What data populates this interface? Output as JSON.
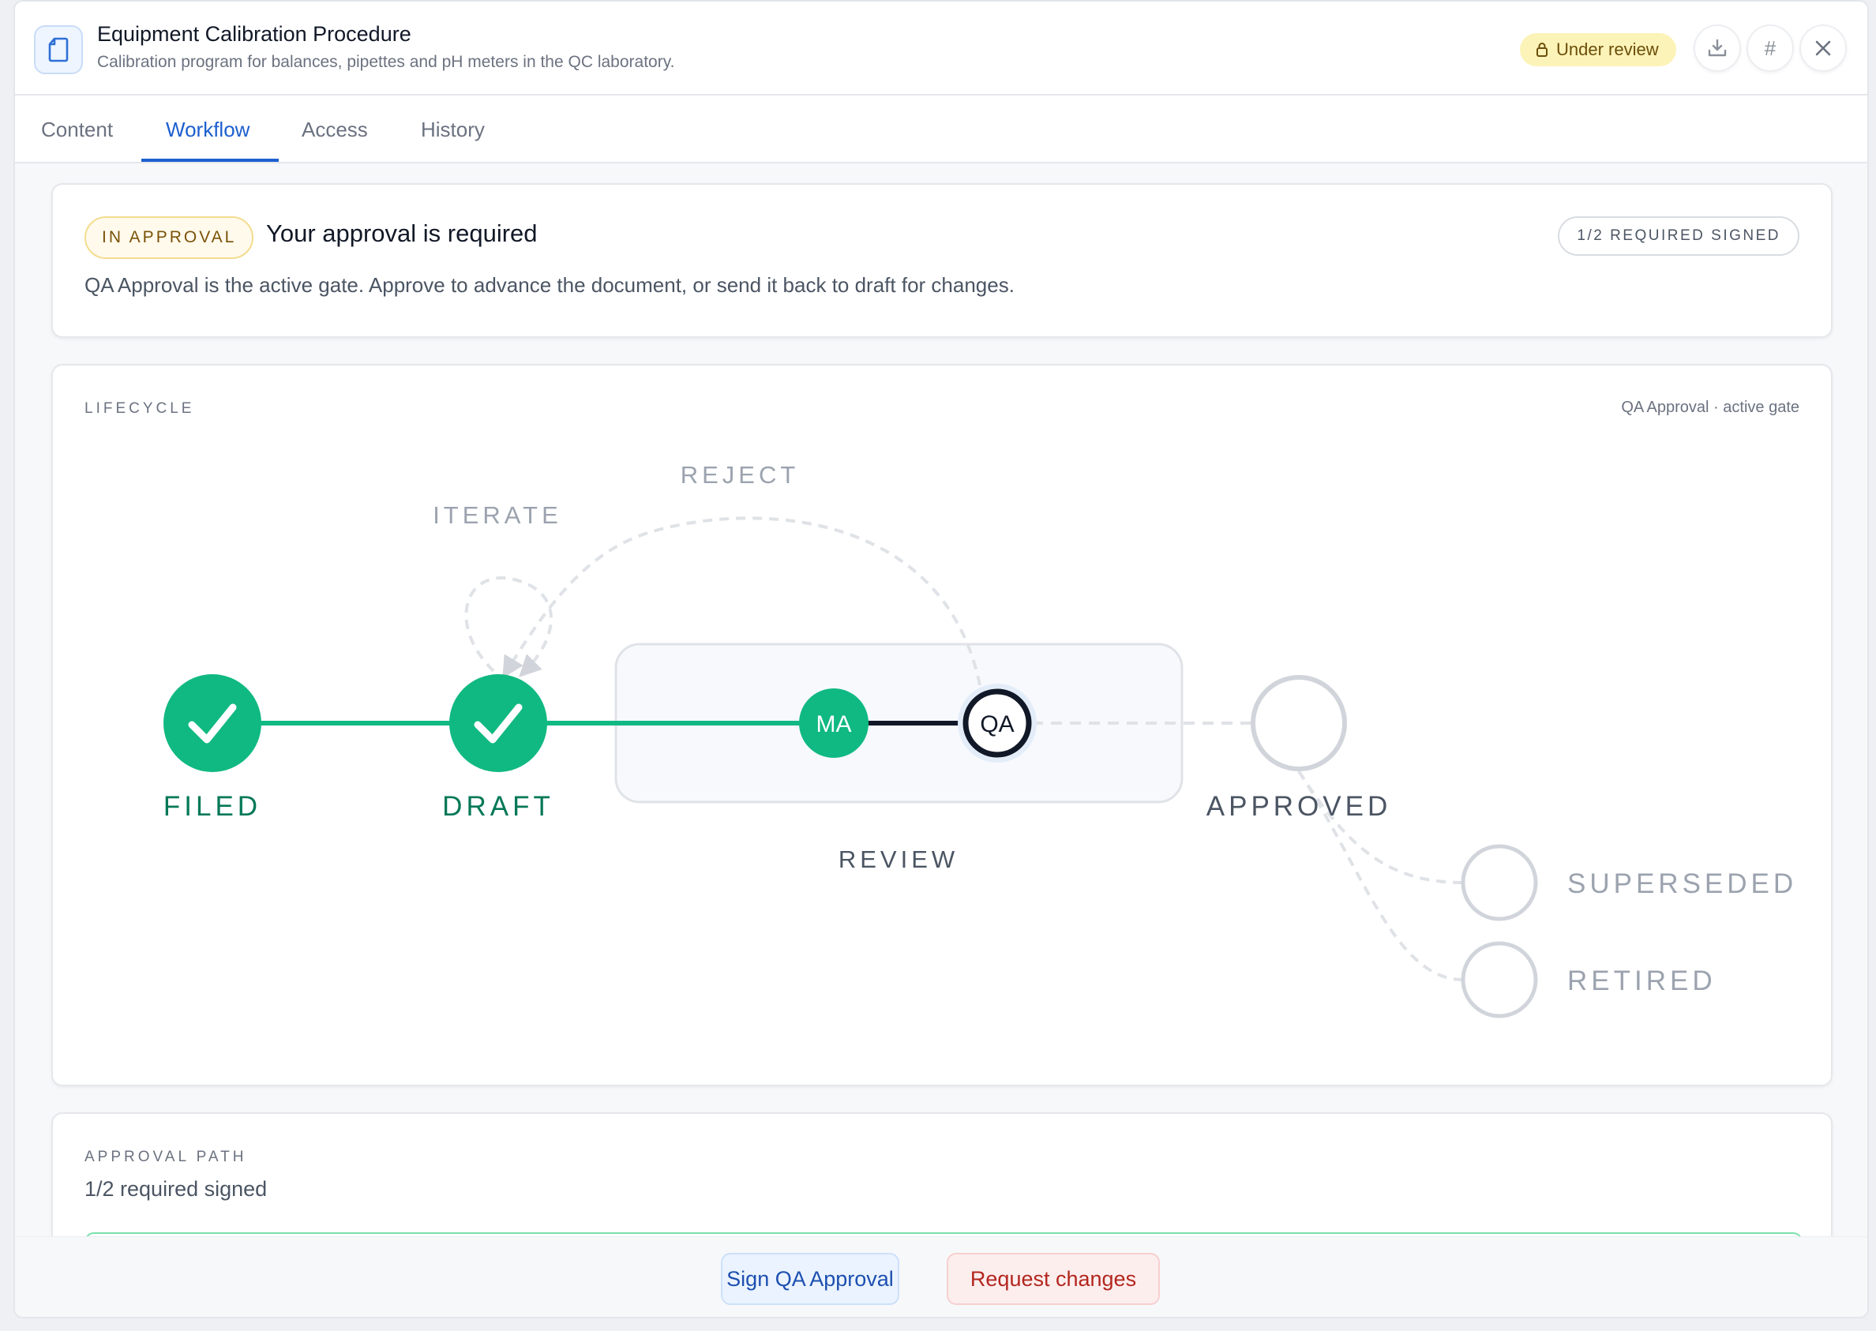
{
  "header": {
    "title": "Equipment Calibration Procedure",
    "subtitle": "Calibration program for balances, pipettes and pH meters in the QC laboratory.",
    "status": "Under review",
    "download_icon": "download-icon",
    "hash_label": "#",
    "close_icon": "close-icon"
  },
  "tabs": [
    {
      "label": "Content",
      "active": false
    },
    {
      "label": "Workflow",
      "active": true
    },
    {
      "label": "Access",
      "active": false
    },
    {
      "label": "History",
      "active": false
    }
  ],
  "approval_card": {
    "badge": "IN APPROVAL",
    "title": "Your approval is required",
    "description": "QA Approval is the active gate. Approve to advance the document, or send it back to draft for changes.",
    "signed": "1/2 REQUIRED SIGNED"
  },
  "lifecycle": {
    "label": "LIFECYCLE",
    "note": "QA Approval · active gate",
    "stages": {
      "filed": "FILED",
      "draft": "DRAFT",
      "review": "REVIEW",
      "approved": "APPROVED",
      "superseded": "SUPERSEDED",
      "retired": "RETIRED"
    },
    "gates": {
      "ma": "MA",
      "qa": "QA"
    },
    "transitions": {
      "iterate": "ITERATE",
      "reject": "REJECT"
    },
    "colors": {
      "done": "#10b981",
      "active": "#111827",
      "pending": "#d1d5db"
    }
  },
  "approval_path": {
    "label": "APPROVAL PATH",
    "summary": "1/2 required signed"
  },
  "footer": {
    "sign_label": "Sign QA Approval",
    "request_label": "Request changes"
  }
}
